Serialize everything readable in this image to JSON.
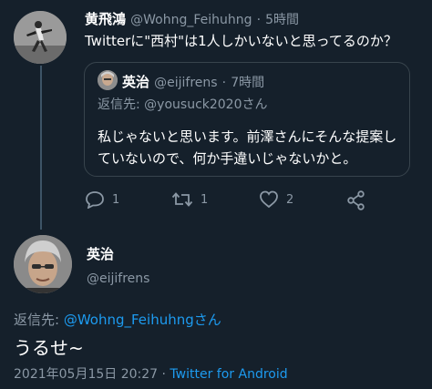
{
  "tweet": {
    "author_name": "黄飛鴻",
    "author_handle": "@Wohng_Feihuhng",
    "time_sep": "·",
    "time": "5時間",
    "text": "Twitterに\"西村\"は1人しかいないと思ってるのか？"
  },
  "quoted": {
    "author_name": "英治",
    "author_handle": "@eijifrens",
    "time_sep": "·",
    "time": "7時間",
    "reply_prefix": "返信先: ",
    "reply_handle": "@yousuck2020さん",
    "text": "私じゃないと思います。前澤さんにそんな提案していないので、何か手違いじゃないかと。"
  },
  "actions": {
    "reply_count": "1",
    "retweet_count": "1",
    "like_count": "2"
  },
  "reply": {
    "author_name": "英治",
    "author_handle": "@eijifrens",
    "reply_prefix": "返信先: ",
    "reply_handle": "@Wohng_Feihuhngさん",
    "text": "うるせ~",
    "timestamp": "2021年05月15日 20:27",
    "timestamp_sep": "·",
    "client": "Twitter for Android"
  },
  "colors": {
    "background": "#15202b",
    "accent": "#1d9bf0",
    "muted": "#8b98a5"
  }
}
